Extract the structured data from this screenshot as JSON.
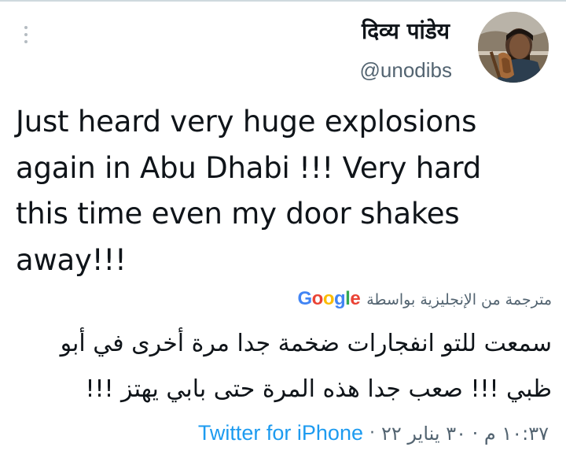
{
  "tweet": {
    "display_name": "दिव्य पांडेय",
    "handle": "@unodibs",
    "text": "Just heard very huge explosions\nagain in Abu Dhabi !!! Very hard\nthis time even my door shakes\naway!!!",
    "translation_label": "مترجمة من الإنجليزية بواسطة",
    "translation_provider": {
      "letters": [
        "G",
        "o",
        "o",
        "g",
        "l",
        "e"
      ],
      "colors": [
        "#4285f4",
        "#ea4335",
        "#fbbc05",
        "#4285f4",
        "#34a853",
        "#ea4335"
      ]
    },
    "translated_text": "سمعت للتو انفجارات ضخمة جدا مرة أخرى في أبو\nظبي !!! صعب جدا هذه المرة حتى بابي يهتز !!!",
    "timestamp": "١٠:٣٧ م · ٣٠ يناير ٢٢",
    "separator": "·",
    "source": "Twitter for iPhone"
  },
  "icons": {
    "more": "more-vertical-icon",
    "avatar": "profile-avatar"
  },
  "colors": {
    "link": "#1d9bf0",
    "secondary_text": "#536471",
    "primary_text": "#0f1419"
  }
}
